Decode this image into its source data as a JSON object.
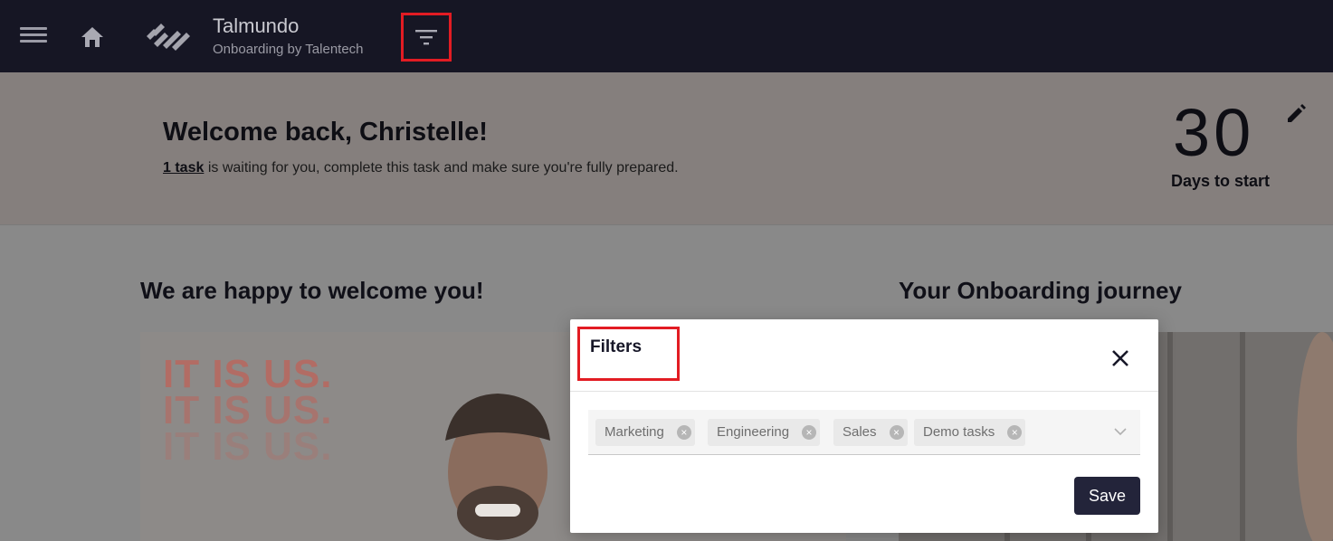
{
  "header": {
    "brand_name": "Talmundo",
    "brand_sub": "Onboarding by Talentech",
    "icons": [
      "menu-icon",
      "home-icon",
      "talmundo-logo",
      "filter-icon"
    ]
  },
  "hero": {
    "greeting": "Welcome back, Christelle!",
    "task_link": "1 task",
    "task_text": " is waiting for you, complete this task and make sure you're fully prepared.",
    "days_count": "30",
    "days_label": "Days to start",
    "edit_icon": "pencil-icon"
  },
  "sections": {
    "welcome_heading": "We are happy to welcome you!",
    "journey_heading": "Your Onboarding journey",
    "slogan": [
      "IT IS US.",
      "IT IS US.",
      "IT IS US."
    ]
  },
  "filters_modal": {
    "title": "Filters",
    "chips": [
      "Marketing",
      "Engineering",
      "Sales",
      "Demo tasks"
    ],
    "save_label": "Save",
    "close_icon": "close-icon",
    "dropdown_icon": "chevron-down-icon"
  },
  "colors": {
    "topbar": "#161624",
    "highlight": "#e21c23",
    "save_button": "#23243a"
  }
}
